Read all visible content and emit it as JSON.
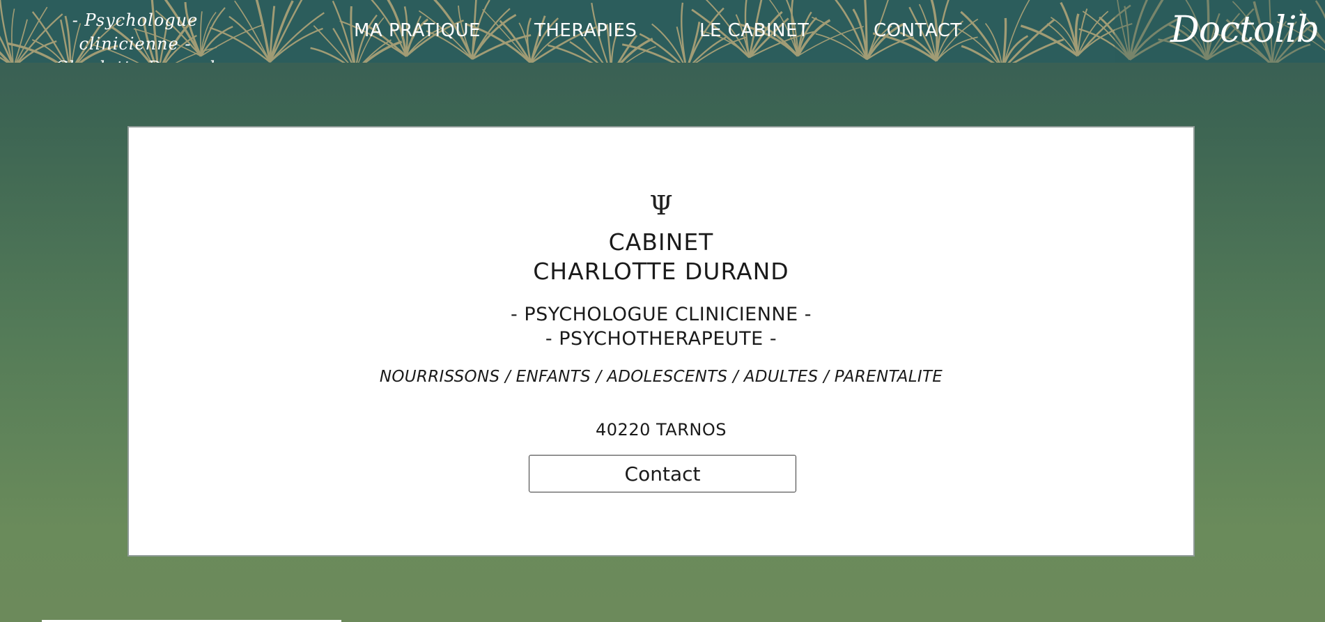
{
  "header": {
    "logo_line1": "- Psychologue clinicienne -",
    "logo_line2": "Charlotte Durand",
    "nav": [
      {
        "label": "MA PRATIQUE"
      },
      {
        "label": "THERAPIES"
      },
      {
        "label": "LE CABINET"
      },
      {
        "label": "CONTACT"
      }
    ],
    "doctolib_label": "Doctolib"
  },
  "card": {
    "symbol": "Ψ",
    "title_line1": "CABINET",
    "title_line2": "CHARLOTTE DURAND",
    "subtitle_line1": "- PSYCHOLOGUE CLINICIENNE -",
    "subtitle_line2": "- PSYCHOTHERAPEUTE -",
    "audience": "NOURRISSONS / ENFANTS / ADOLESCENTS / ADULTES / PARENTALITE",
    "address": "40220 TARNOS",
    "contact_button": "Contact"
  },
  "colors": {
    "header_bg": "#2c5d5c",
    "leaf": "#c9b27e",
    "gradient_top": "#375b55",
    "gradient_bottom": "#6c8a5b",
    "card_bg": "#ffffff"
  }
}
